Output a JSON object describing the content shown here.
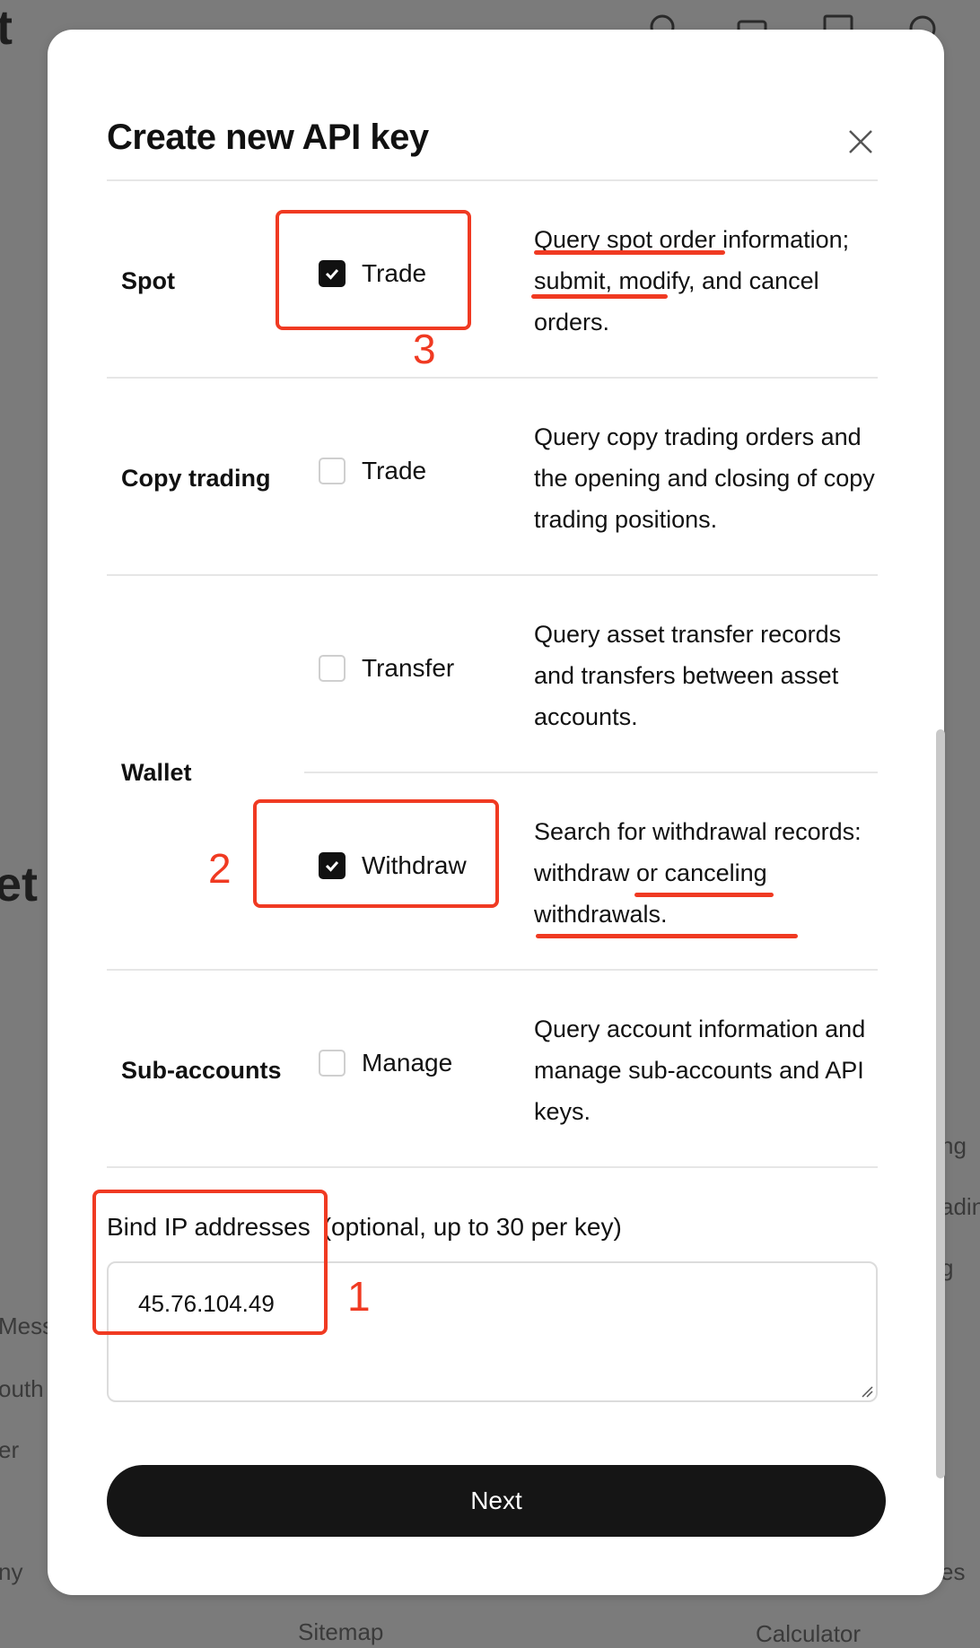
{
  "background": {
    "fragments": [
      "t",
      "et",
      "Mess",
      "outh",
      "er",
      "ny",
      "ng",
      "adin",
      "g",
      "es",
      "Sitemap",
      "Calculator"
    ]
  },
  "modal": {
    "title": "Create new API key",
    "close_icon": "close-icon"
  },
  "permissions": [
    {
      "category": "Spot",
      "option": "Trade",
      "checked": true,
      "description": "Query spot order information; submit, modify, and cancel orders."
    },
    {
      "category": "Copy trading",
      "option": "Trade",
      "checked": false,
      "description": "Query copy trading orders and the opening and closing of copy trading positions."
    },
    {
      "category": "Wallet",
      "option": "Transfer",
      "checked": false,
      "description": "Query asset transfer records and transfers between asset accounts."
    },
    {
      "category": "",
      "option": "Withdraw",
      "checked": true,
      "description": "Search for withdrawal records: withdraw or canceling withdrawals."
    },
    {
      "category": "Sub-accounts",
      "option": "Manage",
      "checked": false,
      "description": "Query account information and manage sub-accounts and API keys."
    }
  ],
  "ip": {
    "label": "Bind IP addresses",
    "hint": "(optional, up to 30 per key)",
    "value": "45.76.104.49"
  },
  "next_label": "Next",
  "annotations": [
    "1",
    "2",
    "3"
  ],
  "colors": {
    "annotation": "#f03a22",
    "button": "#151515",
    "overlay": "#7b7b7b"
  }
}
